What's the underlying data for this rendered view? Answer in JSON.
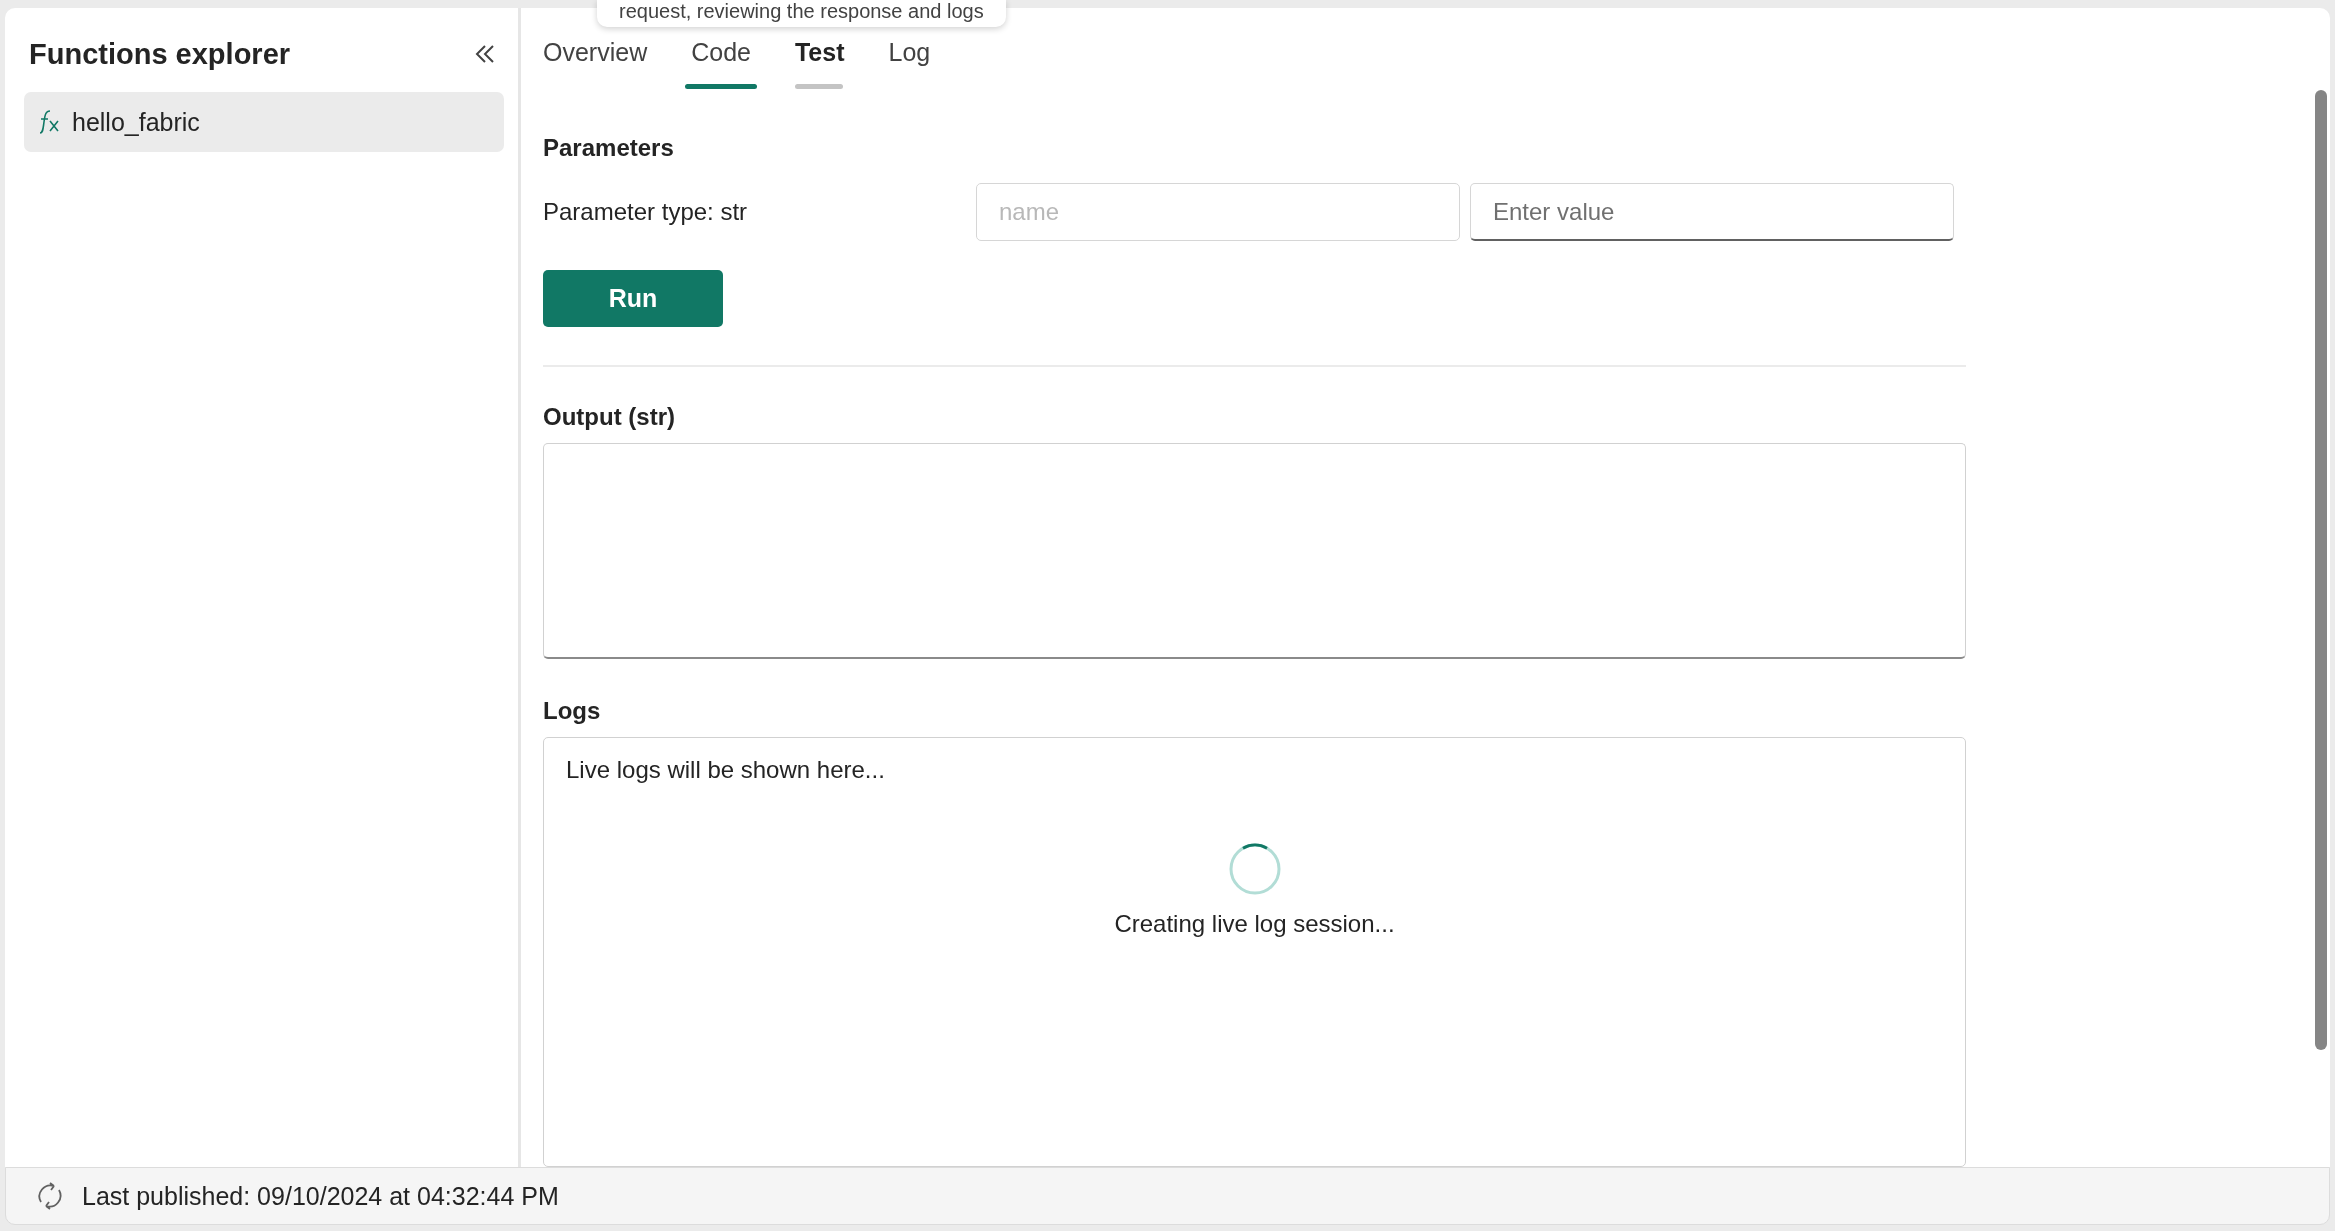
{
  "sidebar": {
    "title": "Functions explorer",
    "items": [
      {
        "label": "hello_fabric",
        "selected": true
      }
    ]
  },
  "tabs": [
    {
      "label": "Overview",
      "selected": false,
      "underlined": false,
      "hovered": false
    },
    {
      "label": "Code",
      "selected": false,
      "underlined": true,
      "hovered": false
    },
    {
      "label": "Test",
      "selected": true,
      "underlined": false,
      "hovered": true
    },
    {
      "label": "Log",
      "selected": false,
      "underlined": false,
      "hovered": false
    }
  ],
  "tooltip": {
    "text": "request, reviewing the response and logs"
  },
  "parameters": {
    "title": "Parameters",
    "rows": [
      {
        "label": "Parameter type: str",
        "name_placeholder": "name",
        "value_placeholder": "Enter value"
      }
    ],
    "run_button": "Run"
  },
  "output": {
    "title": "Output (str)"
  },
  "logs": {
    "title": "Logs",
    "text": "Live logs will be shown here...",
    "status": "Creating live log session..."
  },
  "status_bar": {
    "text": "Last published: 09/10/2024 at 04:32:44 PM"
  }
}
